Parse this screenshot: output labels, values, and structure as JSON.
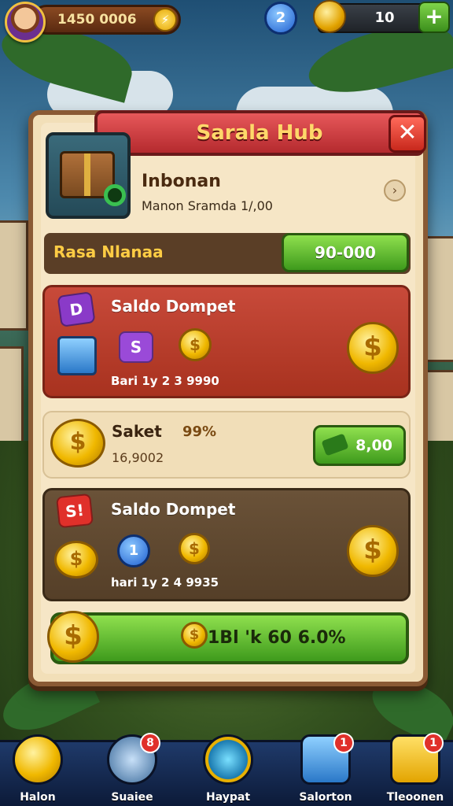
{
  "topbar": {
    "coins_value": "1450 0006",
    "blue_orb_label": "2",
    "gold_value": "10",
    "plus_label": "+"
  },
  "panel": {
    "title": "Sarala Hub",
    "close_label": "✕",
    "info_title": "Inbonan",
    "info_subtitle": "Manon Sramda 1/,00",
    "chevron": "›",
    "rasa_label": "Rasa Nlanaa",
    "rasa_button": "90-000"
  },
  "cards": {
    "card1": {
      "title": "Saldo Dompet",
      "badge_d": "D",
      "badge_s": "S",
      "meta": "Bari 1y 2 3 9990",
      "coin_glyph": "$"
    },
    "card2": {
      "title": "Saket",
      "percent": "99%",
      "subtitle": "16,9002",
      "button": "8,00",
      "coin_glyph": "$"
    },
    "card3": {
      "title": "Saldo Dompet",
      "badge": "S!",
      "orb_label": "1",
      "meta": "hari 1y 2 4 9935",
      "coin_glyph": "$"
    }
  },
  "cta": {
    "label": "1Bl 'k 60 6.0%",
    "coin_glyph": "$"
  },
  "nav": [
    {
      "label": "Halon",
      "badge": ""
    },
    {
      "label": "Suaiee",
      "badge": "8"
    },
    {
      "label": "Haypat",
      "badge": ""
    },
    {
      "label": "Salorton",
      "badge": "1"
    },
    {
      "label": "Tleoonen",
      "badge": "1"
    }
  ],
  "colors": {
    "panel_bg": "#f2dfb8",
    "title_red": "#c8393a",
    "title_text": "#ffd86a",
    "green_button": "#5cb82c",
    "card_red": "#b83c2a",
    "card_brown": "#5f4830",
    "nav_bg": "#142a52"
  }
}
